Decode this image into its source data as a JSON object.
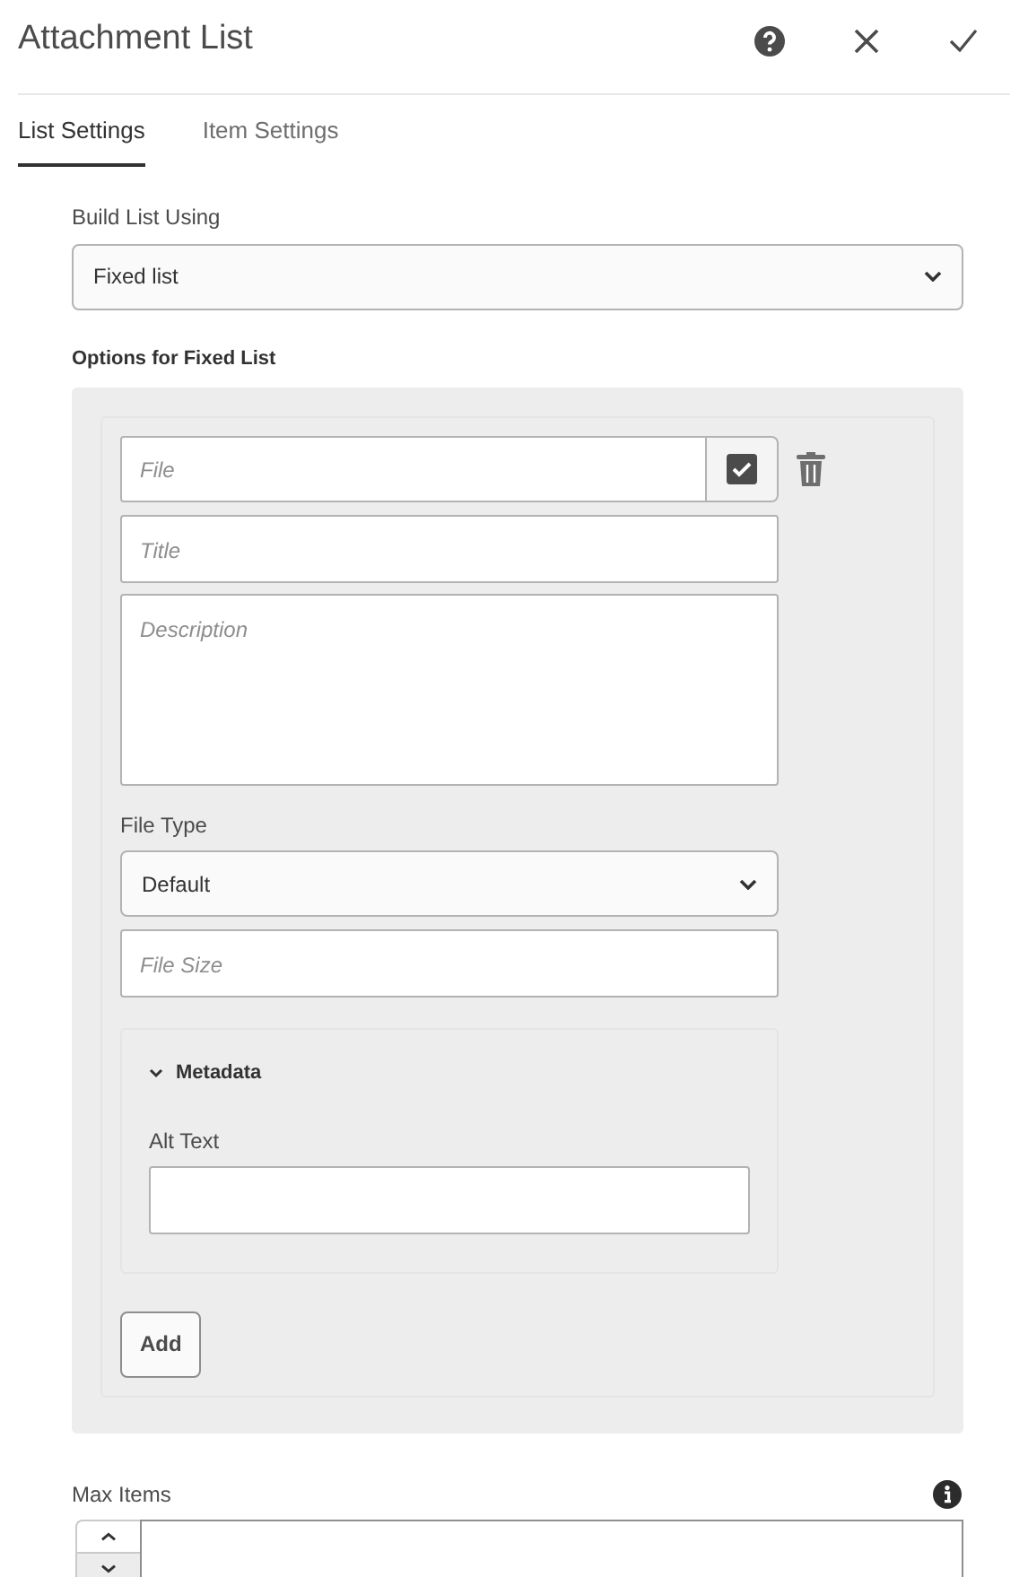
{
  "window": {
    "title": "Attachment List"
  },
  "tabs": [
    {
      "label": "List Settings",
      "selected": true
    },
    {
      "label": "Item Settings",
      "selected": false
    }
  ],
  "build_list": {
    "label": "Build List Using",
    "value": "Fixed list"
  },
  "options": {
    "heading": "Options for Fixed List",
    "item": {
      "file": {
        "placeholder": "File",
        "checked": true
      },
      "title": {
        "placeholder": "Title"
      },
      "description": {
        "placeholder": "Description"
      },
      "file_type": {
        "label": "File Type",
        "value": "Default"
      },
      "file_size": {
        "placeholder": "File Size"
      },
      "metadata": {
        "heading": "Metadata",
        "expanded": true,
        "alt_text_label": "Alt Text"
      }
    },
    "add_button": "Add"
  },
  "max_items": {
    "label": "Max Items"
  }
}
